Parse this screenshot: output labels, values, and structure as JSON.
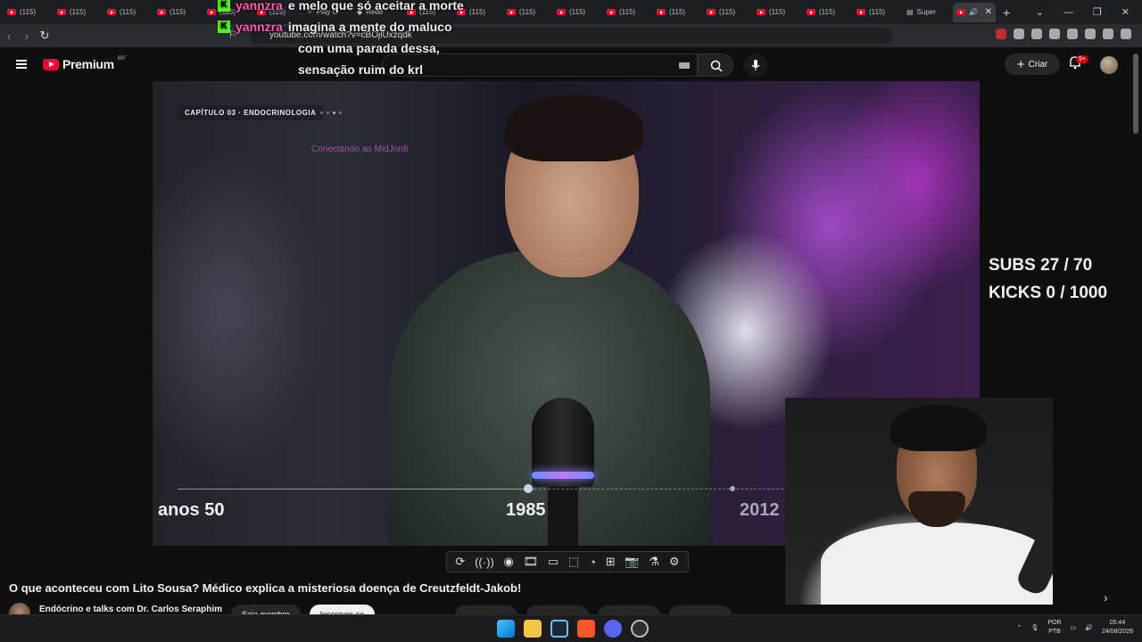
{
  "browser": {
    "tabs": [
      {
        "label": "(115)"
      },
      {
        "label": "(115)"
      },
      {
        "label": "(115)"
      },
      {
        "label": "(115)"
      },
      {
        "label": "(115)"
      },
      {
        "label": "(115)"
      },
      {
        "label": "Play C"
      },
      {
        "label": "Rede"
      },
      {
        "label": "(115)"
      },
      {
        "label": "(115)"
      },
      {
        "label": "(115)"
      },
      {
        "label": "(115)"
      },
      {
        "label": "(115)"
      },
      {
        "label": "(115)"
      },
      {
        "label": "(115)"
      },
      {
        "label": "(115)"
      },
      {
        "label": "(115)"
      },
      {
        "label": "(115)"
      },
      {
        "label": "Super"
      }
    ],
    "url": "youtube.com/watch?v=cBOjlUxzqdk"
  },
  "header": {
    "logo_text": "Premium",
    "logo_region": "BR",
    "create_label": "Criar",
    "notification_badge": "9+"
  },
  "chat": {
    "messages": [
      {
        "platform": "K",
        "user": "yannzra",
        "text": "e melo que só aceitar a morte"
      },
      {
        "platform": "K",
        "user": "yannzra",
        "text": "imagina a mente do maluco"
      }
    ],
    "continuation": [
      "com uma parada dessa,",
      "sensação ruim do krl"
    ]
  },
  "video": {
    "chapter_label": "CAPÍTULO 03 · ENDOCRINOLOGIA",
    "overlay_text": "Conectando ao MidJordi",
    "timeline_years": [
      "anos 50",
      "1985",
      "2012"
    ]
  },
  "stream_overlay": {
    "subs": "SUBS 27 / 70",
    "kicks": "KICKS 0 / 1000"
  },
  "player_controls": {
    "icons": [
      "loop-icon",
      "broadcast-icon",
      "watch-icon",
      "film-icon",
      "miniplayer-icon",
      "theater-icon",
      "speed-icon",
      "add-icon",
      "screenshot-icon",
      "lab-icon",
      "settings-icon"
    ],
    "glyphs": [
      "⟳",
      "((·))",
      "◉",
      "🎞",
      "▭",
      "⬚",
      "◔",
      "⊞",
      "📷",
      "⚗",
      "⚙"
    ]
  },
  "video_info": {
    "title": "O que aconteceu com Lito Sousa? Médico explica a misteriosa doença de Creutzfeldt-Jakob!",
    "channel_name": "Endócrino e talks com Dr. Carlos Seraphim",
    "join_label": "Seja membro",
    "subscribe_label": "Inscrever-se"
  },
  "taskbar": {
    "language": "POR",
    "layout": "PTB",
    "time": "05:44",
    "date": "24/08/2026"
  },
  "colors": {
    "youtube_red": "#ff0033",
    "chat_username": "#ff5ab4",
    "kick_green": "#53fc18"
  }
}
